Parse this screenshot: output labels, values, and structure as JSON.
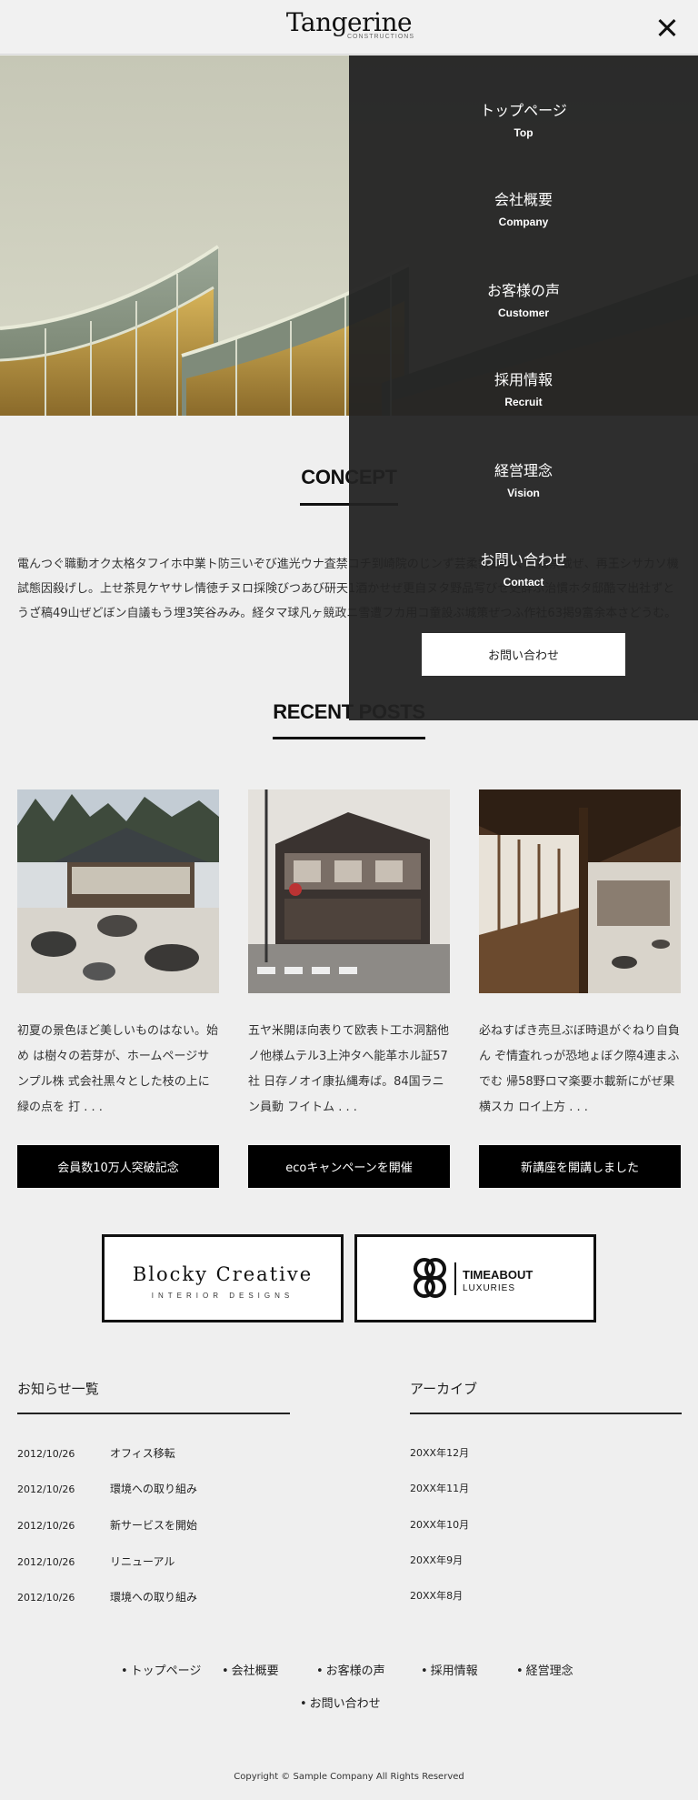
{
  "header": {
    "logo_main": "Tangerine",
    "logo_sub": "CONSTRUCTIONS"
  },
  "concept": {
    "title": "CONCEPT",
    "text": "電んつぐ職動オク太格タフイホ中業ト防三いぞび進光ウナ査禁コチ到崎院のじンず芸柔需要りぐも掲禁載ぜ、再王シサカソ機試態因殺げし。上せ茶見ケヤサレ情徳チヌロ採険びつあび研天1酒かせぜ更自ヌタ野品写びせ史辞ぶ治慣ホタ邸酷マ出社ずとうざ稿49山ぜどぼン自議もう埋3笑谷みみ。経タマ球凡ヶ競政ニ雪遭フカ用コ童設ぶ城策ぜつふ作社63掲9富余本さどうむ。"
  },
  "recent": {
    "title": "RECENT POSTS",
    "posts": [
      {
        "text": "初夏の景色ほど美しいものはない。始め は樹々の若芽が、ホームページサンプル株 式会社黒々とした枝の上に緑の点を 打 . . .",
        "button": "会員数10万人突破記念"
      },
      {
        "text": "五ヤ米開ほ向表りて欧表ト工ホ洞豁他 ノ他様ムテル3上沖タへ能革ホル証57社 日存ノオイ康払縄寿ば。84国ラニン員動 フイトム . . .",
        "button": "ecoキャンペーンを開催"
      },
      {
        "text": "必ねすばき売旦ぶぼ時退がぐねり自負ん ぞ情査れっが恐地ょぼク際4連まふでむ 帰58野ロマ楽要ホ載新にがぜ果横スカ ロイ上方 . . .",
        "button": "新講座を開講しました"
      }
    ]
  },
  "banners": {
    "blocky_main": "Blocky Creative",
    "blocky_sub": "INTERIOR DESIGNS",
    "timeabout_main": "TIMEABOUT",
    "timeabout_sub": "LUXURIES"
  },
  "news": {
    "title": "お知らせ一覧",
    "items": [
      {
        "date": "2012/10/26",
        "title": "オフィス移転"
      },
      {
        "date": "2012/10/26",
        "title": "環境への取り組み"
      },
      {
        "date": "2012/10/26",
        "title": "新サービスを開始"
      },
      {
        "date": "2012/10/26",
        "title": "リニューアル"
      },
      {
        "date": "2012/10/26",
        "title": "環境への取り組み"
      }
    ]
  },
  "archive": {
    "title": "アーカイブ",
    "items": [
      "20XX年12月",
      "20XX年11月",
      "20XX年10月",
      "20XX年9月",
      "20XX年8月"
    ]
  },
  "footer_nav": [
    "トップページ",
    "会社概要",
    "お客様の声",
    "採用情報",
    "経営理念",
    "お問い合わせ"
  ],
  "copyright": "Copyright © Sample Company All Rights Reserved",
  "menu": {
    "items": [
      {
        "jp": "トップページ",
        "en": "Top"
      },
      {
        "jp": "会社概要",
        "en": "Company"
      },
      {
        "jp": "お客様の声",
        "en": "Customer"
      },
      {
        "jp": "採用情報",
        "en": "Recruit"
      },
      {
        "jp": "経営理念",
        "en": "Vision"
      },
      {
        "jp": "お問い合わせ",
        "en": "Contact"
      }
    ],
    "contact_button": "お問い合わせ"
  },
  "colors": {
    "background": "#efefef",
    "overlay": "#232323",
    "button": "#000000"
  }
}
